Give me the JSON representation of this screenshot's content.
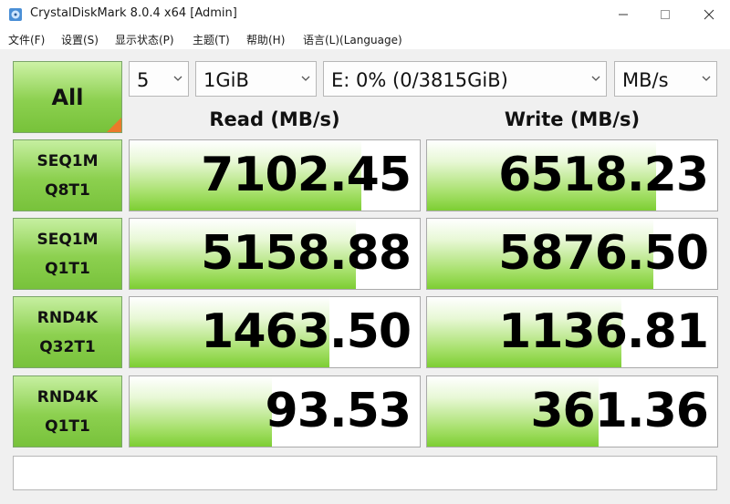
{
  "window": {
    "title": "CrystalDiskMark 8.0.4 x64 [Admin]"
  },
  "menu": [
    "文件(F)",
    "设置(S)",
    "显示状态(P)",
    "主题(T)",
    "帮助(H)",
    "语言(L)(Language)"
  ],
  "controls": {
    "all_label": "All",
    "count": "5",
    "size": "1GiB",
    "drive": "E: 0% (0/3815GiB)",
    "unit": "MB/s"
  },
  "headers": {
    "read": "Read (MB/s)",
    "write": "Write (MB/s)"
  },
  "tests": [
    {
      "line1": "SEQ1M",
      "line2": "Q8T1",
      "read": "7102.45",
      "write": "6518.23",
      "read_fill": 0.8,
      "write_fill": 0.79
    },
    {
      "line1": "SEQ1M",
      "line2": "Q1T1",
      "read": "5158.88",
      "write": "5876.50",
      "read_fill": 0.78,
      "write_fill": 0.78
    },
    {
      "line1": "RND4K",
      "line2": "Q32T1",
      "read": "1463.50",
      "write": "1136.81",
      "read_fill": 0.69,
      "write_fill": 0.67
    },
    {
      "line1": "RND4K",
      "line2": "Q1T1",
      "read": "93.53",
      "write": "361.36",
      "read_fill": 0.49,
      "write_fill": 0.59
    }
  ],
  "status": {
    "text": ""
  },
  "icons": {
    "app": "crystaldiskmark-icon",
    "select_arrow": "chevron-down-icon"
  },
  "colors": {
    "accent_green": "#8cd04f",
    "corner_orange": "#ea7a2a"
  }
}
